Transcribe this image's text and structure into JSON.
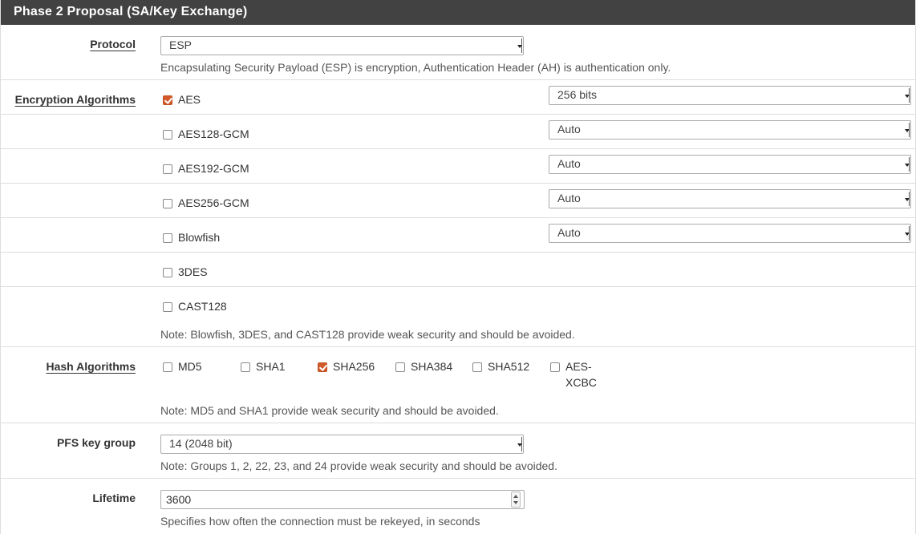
{
  "panel": {
    "title": "Phase 2 Proposal (SA/Key Exchange)"
  },
  "protocol": {
    "label": "Protocol",
    "value": "ESP",
    "help": "Encapsulating Security Payload (ESP) is encryption, Authentication Header (AH) is authentication only."
  },
  "encryption": {
    "label": "Encryption Algorithms",
    "items": [
      {
        "name": "AES",
        "checked": true,
        "keylen": "256 bits"
      },
      {
        "name": "AES128-GCM",
        "checked": false,
        "keylen": "Auto"
      },
      {
        "name": "AES192-GCM",
        "checked": false,
        "keylen": "Auto"
      },
      {
        "name": "AES256-GCM",
        "checked": false,
        "keylen": "Auto"
      },
      {
        "name": "Blowfish",
        "checked": false,
        "keylen": "Auto"
      },
      {
        "name": "3DES",
        "checked": false
      },
      {
        "name": "CAST128",
        "checked": false
      }
    ],
    "note": "Note: Blowfish, 3DES, and CAST128 provide weak security and should be avoided."
  },
  "hash": {
    "label": "Hash Algorithms",
    "items": [
      {
        "name": "MD5",
        "checked": false
      },
      {
        "name": "SHA1",
        "checked": false
      },
      {
        "name": "SHA256",
        "checked": true
      },
      {
        "name": "SHA384",
        "checked": false
      },
      {
        "name": "SHA512",
        "checked": false
      },
      {
        "name_line1": "AES-",
        "name_line2": "XCBC",
        "checked": false
      }
    ],
    "note": "Note: MD5 and SHA1 provide weak security and should be avoided."
  },
  "pfs": {
    "label": "PFS key group",
    "value": "14 (2048 bit)",
    "help": "Note: Groups 1, 2, 22, 23, and 24 provide weak security and should be avoided."
  },
  "lifetime": {
    "label": "Lifetime",
    "value": "3600",
    "help": "Specifies how often the connection must be rekeyed, in seconds"
  },
  "colors": {
    "header_bg": "#424242",
    "checkbox_checked": "#d25a2a",
    "border": "#dddddd"
  }
}
